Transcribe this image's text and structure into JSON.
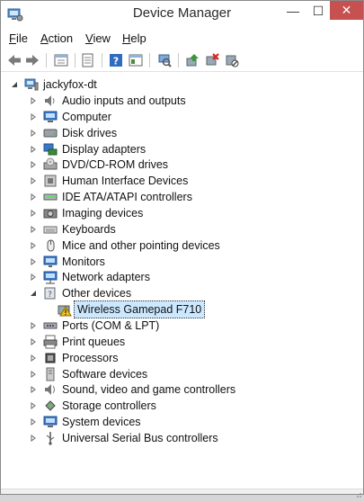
{
  "window": {
    "title": "Device Manager",
    "icons": {
      "app": "device-manager-icon",
      "minimize": "minimize-icon",
      "maximize": "maximize-icon",
      "close": "close-icon"
    },
    "minimize_glyph": "—",
    "maximize_glyph": "☐",
    "close_glyph": "✕",
    "colors": {
      "close_button": "#c75050",
      "selection": "#cce8ff"
    }
  },
  "menu": {
    "file": {
      "accel": "F",
      "rest": "ile"
    },
    "action": {
      "accel": "A",
      "rest": "ction"
    },
    "view": {
      "accel": "V",
      "rest": "iew"
    },
    "help": {
      "accel": "H",
      "rest": "elp"
    }
  },
  "toolbar": {
    "buttons": [
      "back-icon",
      "forward-icon",
      "properties-icon",
      "show-hide-icon",
      "help-icon",
      "console-icon",
      "scan-hardware-icon",
      "update-driver-icon",
      "uninstall-icon",
      "disable-device-icon"
    ]
  },
  "tree": {
    "root": {
      "label": "jackyfox-dt",
      "icon": "computer-root-icon",
      "expanded": true
    },
    "categories": [
      {
        "label": "Audio inputs and outputs",
        "icon": "speaker-icon"
      },
      {
        "label": "Computer",
        "icon": "computer-icon"
      },
      {
        "label": "Disk drives",
        "icon": "disk-drive-icon"
      },
      {
        "label": "Display adapters",
        "icon": "display-adapter-icon"
      },
      {
        "label": "DVD/CD-ROM drives",
        "icon": "dvd-drive-icon"
      },
      {
        "label": "Human Interface Devices",
        "icon": "hid-icon"
      },
      {
        "label": "IDE ATA/ATAPI controllers",
        "icon": "ide-controller-icon"
      },
      {
        "label": "Imaging devices",
        "icon": "camera-icon"
      },
      {
        "label": "Keyboards",
        "icon": "keyboard-icon"
      },
      {
        "label": "Mice and other pointing devices",
        "icon": "mouse-icon"
      },
      {
        "label": "Monitors",
        "icon": "monitor-icon"
      },
      {
        "label": "Network adapters",
        "icon": "network-adapter-icon"
      },
      {
        "label": "Other devices",
        "icon": "unknown-device-icon",
        "expanded": true
      },
      {
        "label": "Wireless Gamepad F710",
        "icon": "warning-device-icon",
        "child": true,
        "selected": true
      },
      {
        "label": "Ports (COM & LPT)",
        "icon": "port-icon"
      },
      {
        "label": "Print queues",
        "icon": "printer-icon"
      },
      {
        "label": "Processors",
        "icon": "processor-icon"
      },
      {
        "label": "Software devices",
        "icon": "software-device-icon"
      },
      {
        "label": "Sound, video and game controllers",
        "icon": "sound-icon"
      },
      {
        "label": "Storage controllers",
        "icon": "storage-controller-icon"
      },
      {
        "label": "System devices",
        "icon": "system-device-icon"
      },
      {
        "label": "Universal Serial Bus controllers",
        "icon": "usb-icon"
      }
    ]
  }
}
